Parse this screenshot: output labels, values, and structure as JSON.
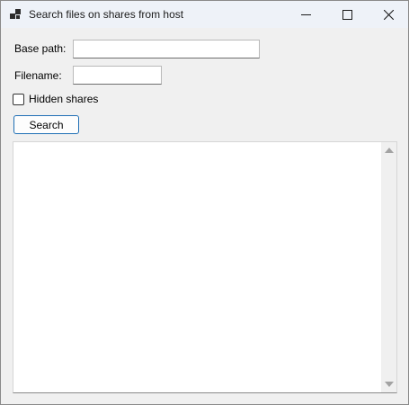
{
  "window": {
    "title": "Search files on shares from host",
    "app_icon": "app-windows-icon",
    "caption_buttons": [
      "minimize-icon",
      "maximize-icon",
      "close-icon"
    ]
  },
  "form": {
    "base_path_label": "Base path:",
    "base_path_value": "",
    "filename_label": "Filename:",
    "filename_value": "",
    "hidden_shares_label": "Hidden shares",
    "hidden_shares_checked": false,
    "search_button_label": "Search"
  },
  "results": {
    "items": []
  },
  "colors": {
    "button_border": "#1f6fb5",
    "titlebar_bg": "#eef2f8",
    "window_bg": "#f0f0f0"
  }
}
